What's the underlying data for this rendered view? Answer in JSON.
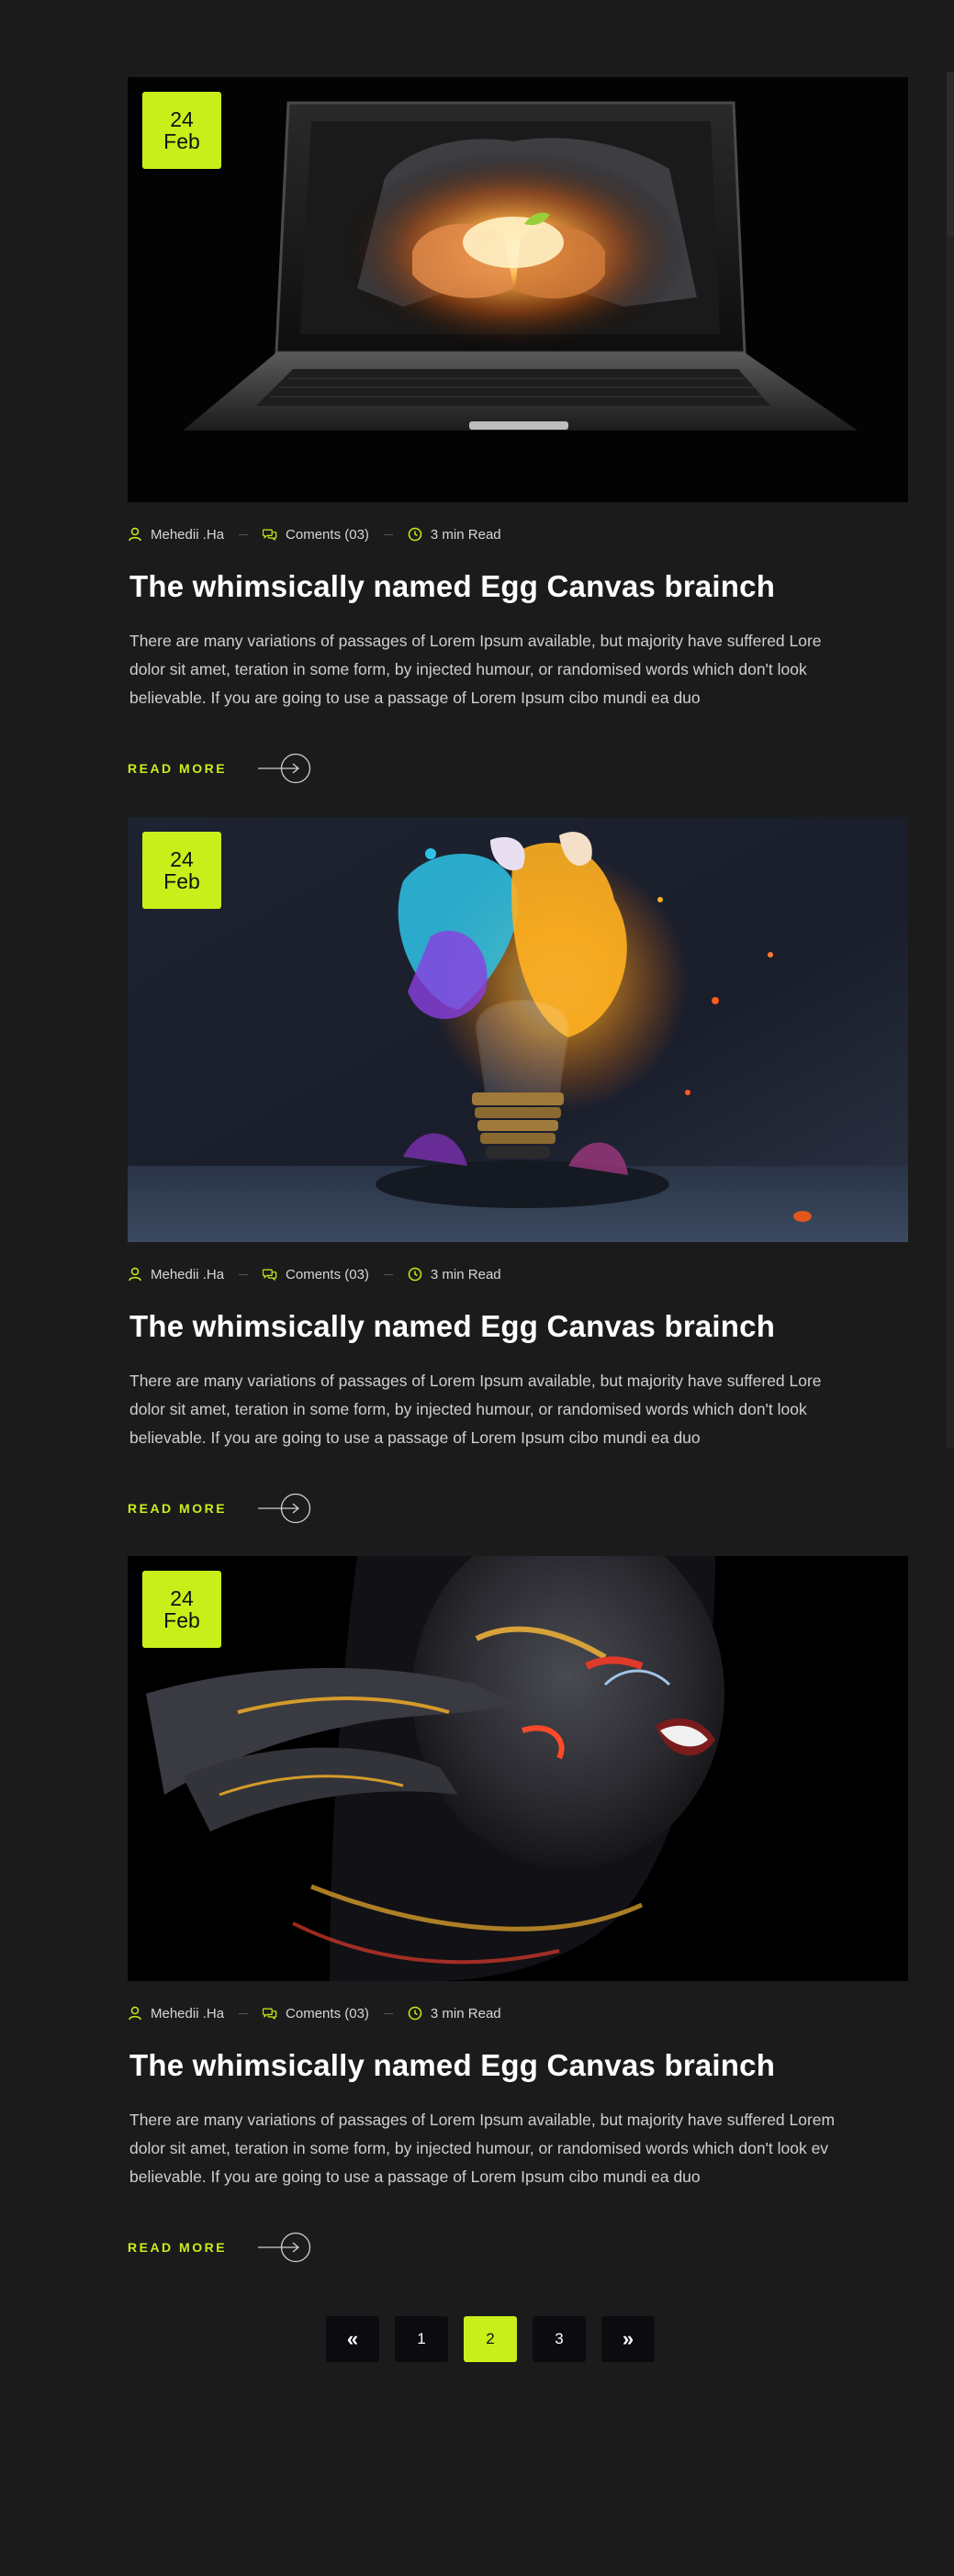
{
  "posts": [
    {
      "date": {
        "day": "24",
        "month": "Feb"
      },
      "author": "Mehedii .Ha",
      "comments": "Coments (03)",
      "read_time": "3 min Read",
      "title": "The whimsically named Egg Canvas brainch",
      "excerpt_lines": [
        "There are many variations of passages of Lorem Ipsum available, but majority have suffered Lore",
        "dolor sit amet, teration in some form, by injected humour, or randomised words which don't look",
        "believable. If you are going to use a passage of Lorem Ipsum cibo mundi ea duo"
      ],
      "read_more": "READ MORE"
    },
    {
      "date": {
        "day": "24",
        "month": "Feb"
      },
      "author": "Mehedii .Ha",
      "comments": "Coments (03)",
      "read_time": "3 min Read",
      "title": "The whimsically named Egg Canvas brainch",
      "excerpt_lines": [
        "There are many variations of passages of Lorem Ipsum available, but majority have suffered Lore",
        "dolor sit amet, teration in some form, by injected humour, or randomised words which don't look",
        "believable. If you are going to use a passage of Lorem Ipsum cibo mundi ea duo"
      ],
      "read_more": "READ MORE"
    },
    {
      "date": {
        "day": "24",
        "month": "Feb"
      },
      "author": "Mehedii .Ha",
      "comments": "Coments (03)",
      "read_time": "3 min Read",
      "title": "The whimsically named Egg Canvas brainch",
      "excerpt_lines": [
        "There are many variations of passages of Lorem Ipsum available, but majority have suffered Lorem",
        "dolor sit amet, teration in some form, by injected humour, or randomised words which don't look ev",
        "believable. If you are going to use a passage of Lorem Ipsum cibo mundi ea duo"
      ],
      "read_more": "READ MORE"
    }
  ],
  "pagination": {
    "prev": "«",
    "pages": [
      "1",
      "2",
      "3"
    ],
    "active": "2",
    "next": "»"
  },
  "colors": {
    "accent": "#c8ef1a",
    "background": "#1b1b1b",
    "page_button": "#0c0c10"
  },
  "icons": {
    "author": "user-icon",
    "comments": "comments-icon",
    "read_time": "clock-icon",
    "read_more": "arrow-right-circle-icon"
  }
}
